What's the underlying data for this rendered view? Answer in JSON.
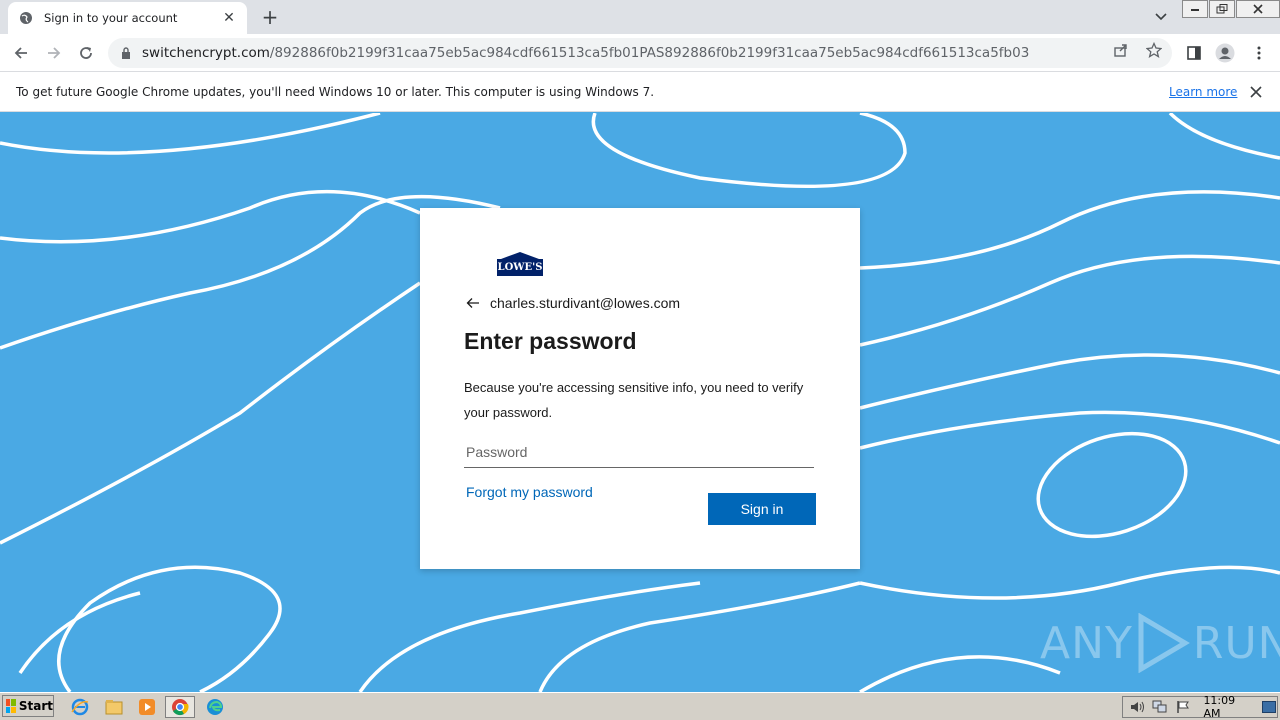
{
  "browser": {
    "tab_title": "Sign in to your account",
    "url_host": "switchencrypt.com",
    "url_path": "/892886f0b2199f31caa75eb5ac984cdf661513ca5fb01PAS892886f0b2199f31caa75eb5ac984cdf661513ca5fb03",
    "new_tab_symbol": "+",
    "tab_close_symbol": "✕"
  },
  "infobar": {
    "message": "To get future Google Chrome updates, you'll need Windows 10 or later. This computer is using Windows 7.",
    "learn_more": "Learn more"
  },
  "signin": {
    "logo_text": "LOWE'S",
    "email": "charles.sturdivant@lowes.com",
    "heading": "Enter password",
    "description": "Because you're accessing sensitive info, you need to verify your password.",
    "password_placeholder": "Password",
    "forgot_link": "Forgot my password",
    "signin_button": "Sign in"
  },
  "watermark": {
    "text_left": "ANY",
    "text_right": "RUN"
  },
  "taskbar": {
    "start_label": "Start",
    "clock": "11:09 AM"
  },
  "colors": {
    "background": "#4aa9e4",
    "primary_button": "#0067b8",
    "link": "#0067b8",
    "logo": "#012169"
  }
}
